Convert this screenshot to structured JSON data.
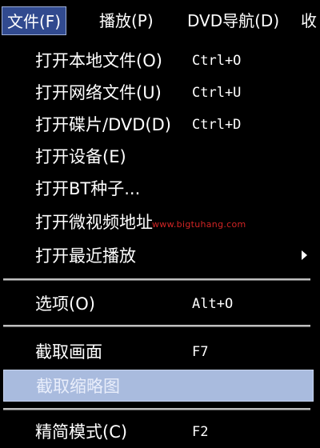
{
  "menubar": {
    "items": [
      {
        "label": "文件(F)"
      },
      {
        "label": "播放(P)"
      },
      {
        "label": "DVD导航(D)"
      },
      {
        "label": "收"
      }
    ]
  },
  "menu": {
    "items": [
      {
        "label": "打开本地文件(O)",
        "shortcut": "Ctrl+O"
      },
      {
        "label": "打开网络文件(U)",
        "shortcut": "Ctrl+U"
      },
      {
        "label": "打开碟片/DVD(D)",
        "shortcut": "Ctrl+D"
      },
      {
        "label": "打开设备(E)",
        "shortcut": ""
      },
      {
        "label": "打开BT种子...",
        "shortcut": ""
      },
      {
        "label": "打开微视频地址",
        "shortcut": ""
      },
      {
        "label": "打开最近播放",
        "shortcut": ""
      },
      {
        "label": "选项(O)",
        "shortcut": "Alt+O"
      },
      {
        "label": "截取画面",
        "shortcut": "F7"
      },
      {
        "label": "截取缩略图",
        "shortcut": ""
      },
      {
        "label": "精简模式(C)",
        "shortcut": "F2"
      }
    ]
  },
  "watermark": "www.bigtuhang.com",
  "colors": {
    "menu_bg": "#000000",
    "highlight": "#a9bbde",
    "active_menubar": "#314a8f",
    "text": "#ffffff",
    "watermark": "#d12424"
  }
}
